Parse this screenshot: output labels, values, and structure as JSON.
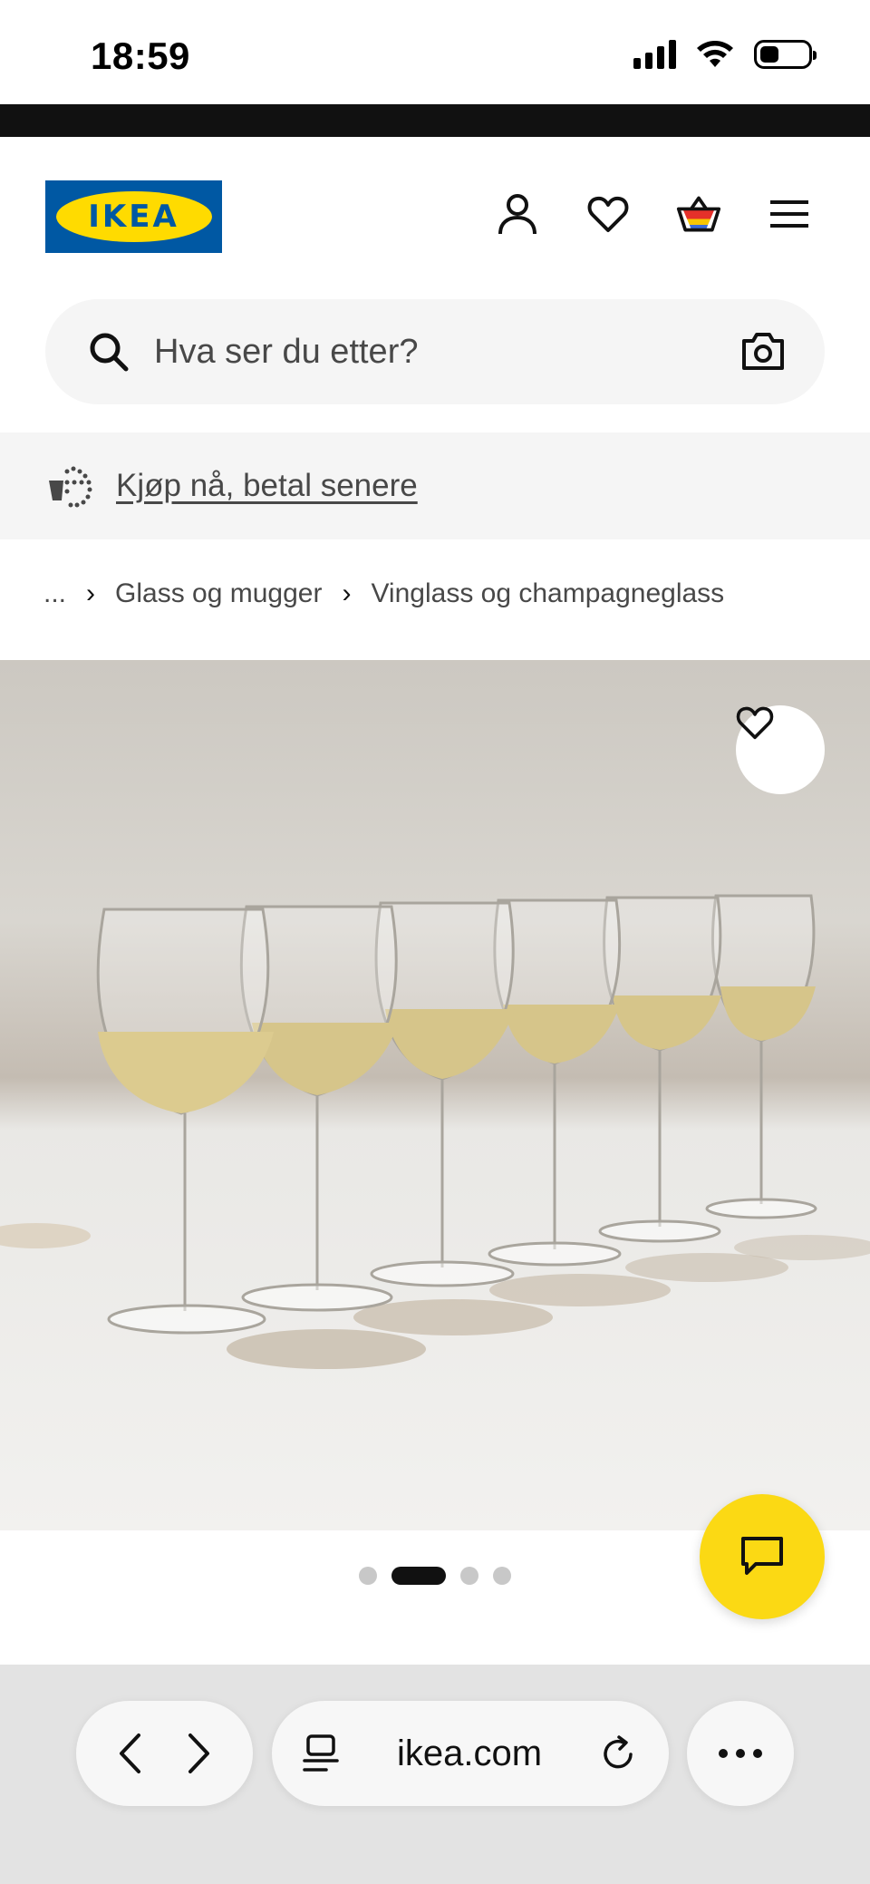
{
  "status_bar": {
    "time": "18:59"
  },
  "header": {
    "logo_text": "IKEA",
    "icons": [
      "person-icon",
      "heart-icon",
      "basket-icon",
      "menu-icon"
    ]
  },
  "search": {
    "placeholder": "Hva ser du etter?"
  },
  "promo": {
    "link_text": "Kjøp nå, betal senere"
  },
  "breadcrumb": {
    "ellipsis": "...",
    "items": [
      "Glass og mugger",
      "Vinglass og champagneglass"
    ]
  },
  "carousel": {
    "slide_count": 4,
    "active_index": 1
  },
  "browser": {
    "url": "ikea.com"
  },
  "colors": {
    "ikea_blue": "#0058a3",
    "ikea_yellow": "#ffdb00",
    "chat_yellow": "#fbd914"
  }
}
